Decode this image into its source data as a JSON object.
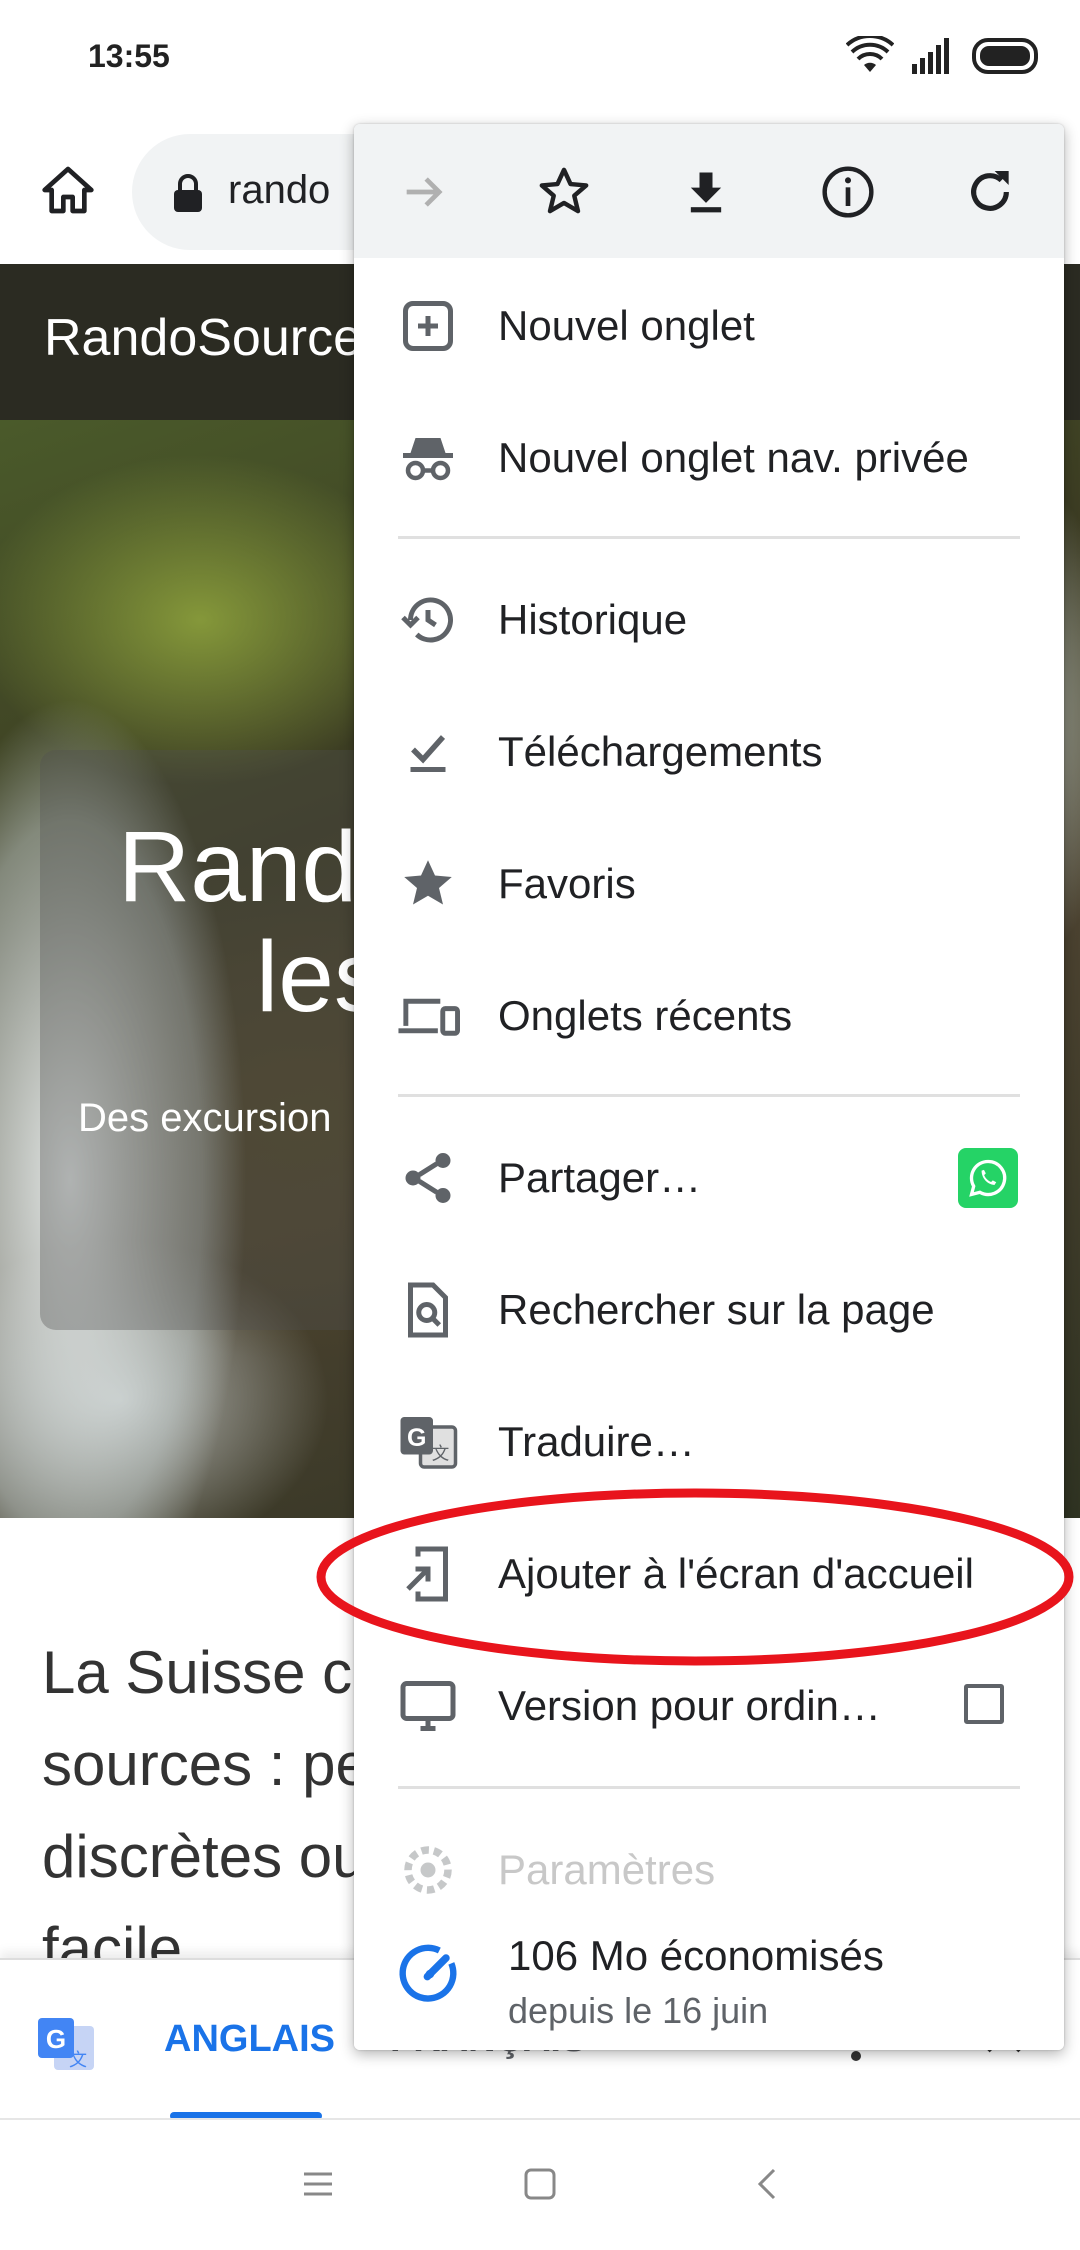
{
  "status_bar": {
    "time": "13:55"
  },
  "toolbar": {
    "url": "rando"
  },
  "page": {
    "site_title": "RandoSource",
    "hero_title_line1": "Rand",
    "hero_title_line2": "les",
    "hero_subtitle": "Des excursion",
    "article_lines": [
      "La Suisse c",
      "sources : pe",
      "discrètes ou",
      "facile"
    ]
  },
  "translate_bar": {
    "source_lang": "ANGLAIS",
    "target_lang": "FRANÇAIS"
  },
  "menu": {
    "top_icons": [
      "forward-icon",
      "bookmark-star-icon",
      "download-icon",
      "info-icon",
      "reload-icon"
    ],
    "items": [
      {
        "label": "Nouvel onglet",
        "icon": "new-tab-icon"
      },
      {
        "label": "Nouvel onglet nav. privée",
        "icon": "incognito-icon"
      },
      {
        "label": "Historique",
        "icon": "history-icon"
      },
      {
        "label": "Téléchargements",
        "icon": "downloads-icon"
      },
      {
        "label": "Favoris",
        "icon": "star-icon"
      },
      {
        "label": "Onglets récents",
        "icon": "devices-icon"
      },
      {
        "label": "Partager…",
        "icon": "share-icon"
      },
      {
        "label": "Rechercher sur la page",
        "icon": "find-in-page-icon"
      },
      {
        "label": "Traduire…",
        "icon": "translate-icon"
      },
      {
        "label": "Ajouter à l'écran d'accueil",
        "icon": "add-to-home-icon"
      },
      {
        "label": "Version pour ordin…",
        "icon": "desktop-icon"
      },
      {
        "label": "Paramètres",
        "icon": "settings-icon"
      }
    ],
    "data_saver": {
      "title": "106 Mo économisés",
      "subtitle": "depuis le 16 juin"
    }
  },
  "colors": {
    "accent": "#1a73e8",
    "highlight": "#e8141c",
    "whatsapp": "#25d366",
    "icon_gray": "#5f6368"
  }
}
